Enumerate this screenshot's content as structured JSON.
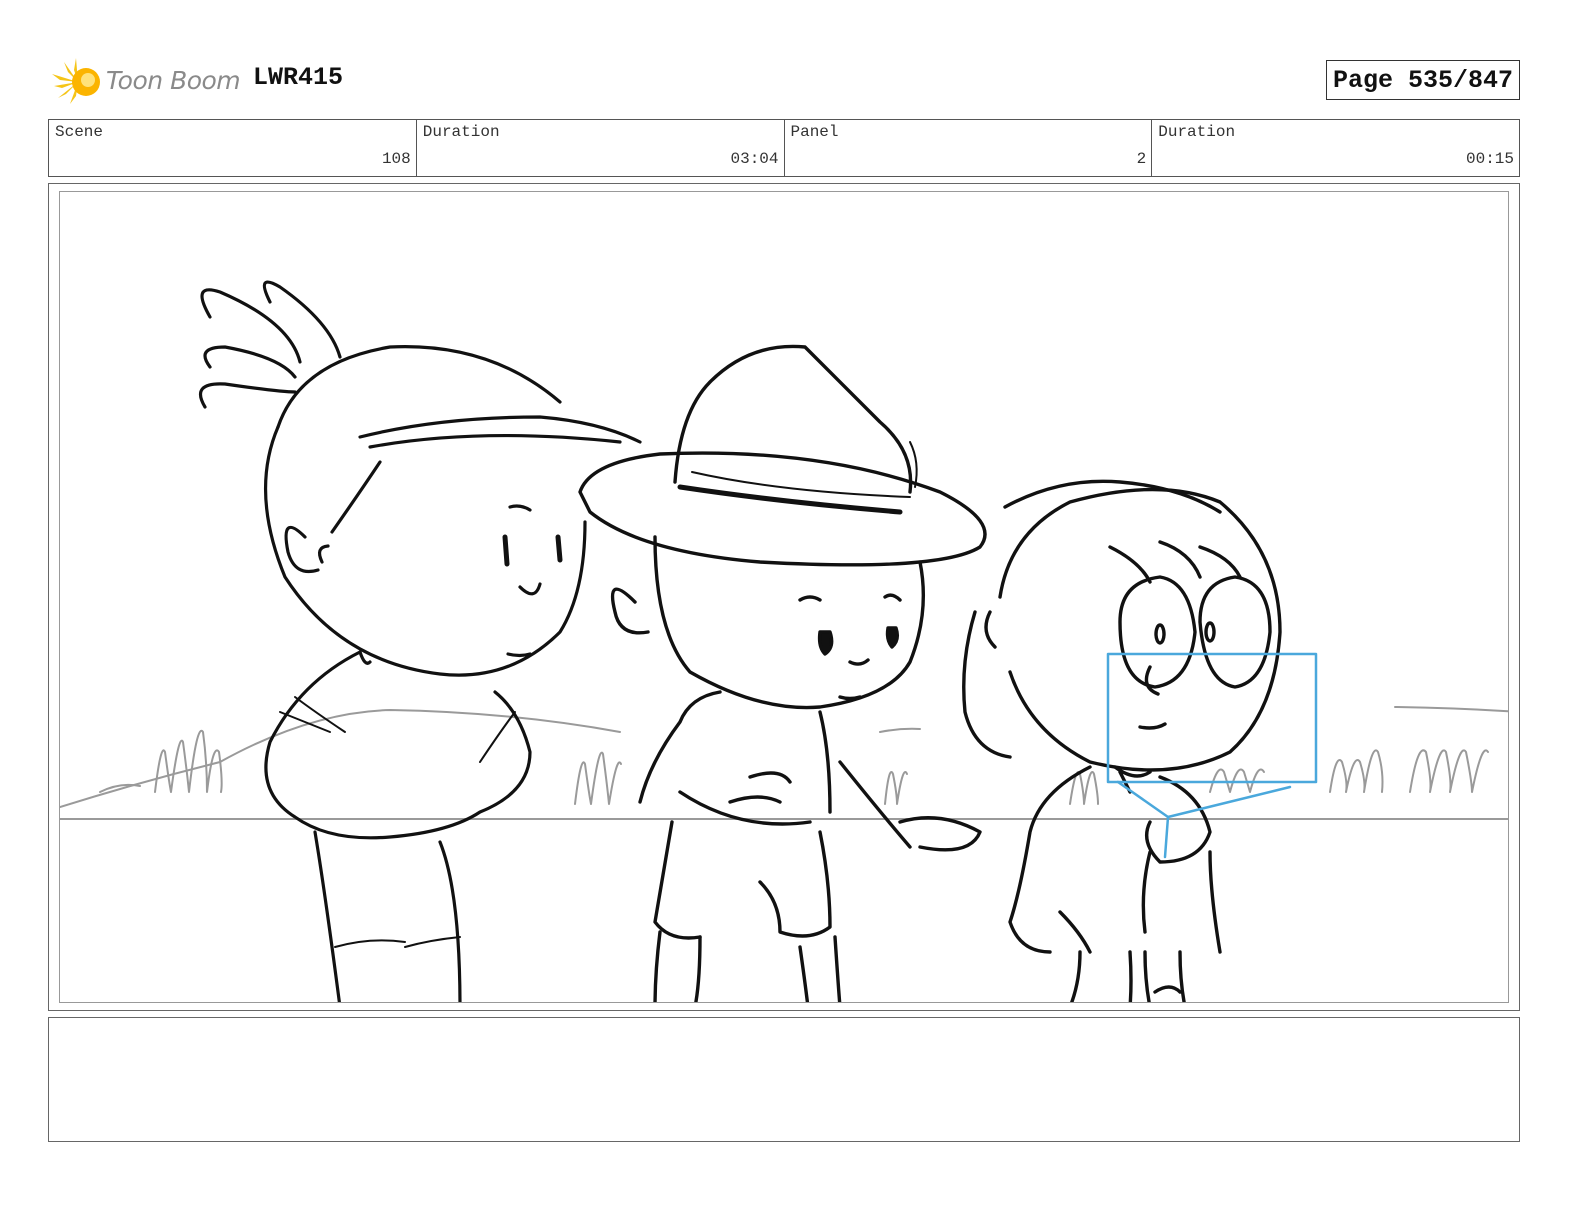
{
  "brand": {
    "name": "Toon Boom",
    "accent": "#f5c518"
  },
  "project": {
    "code": "LWR415"
  },
  "page": {
    "label": "Page 535/847"
  },
  "info": [
    {
      "label": "Scene",
      "value": "108"
    },
    {
      "label": "Duration",
      "value": "03:04"
    },
    {
      "label": "Panel",
      "value": "2"
    },
    {
      "label": "Duration",
      "value": "00:15"
    }
  ],
  "panel": {
    "line_color": "#111111",
    "guide_color": "#4aa8dc",
    "background_line_color": "#9a9a9a"
  },
  "notes": {
    "text": ""
  }
}
